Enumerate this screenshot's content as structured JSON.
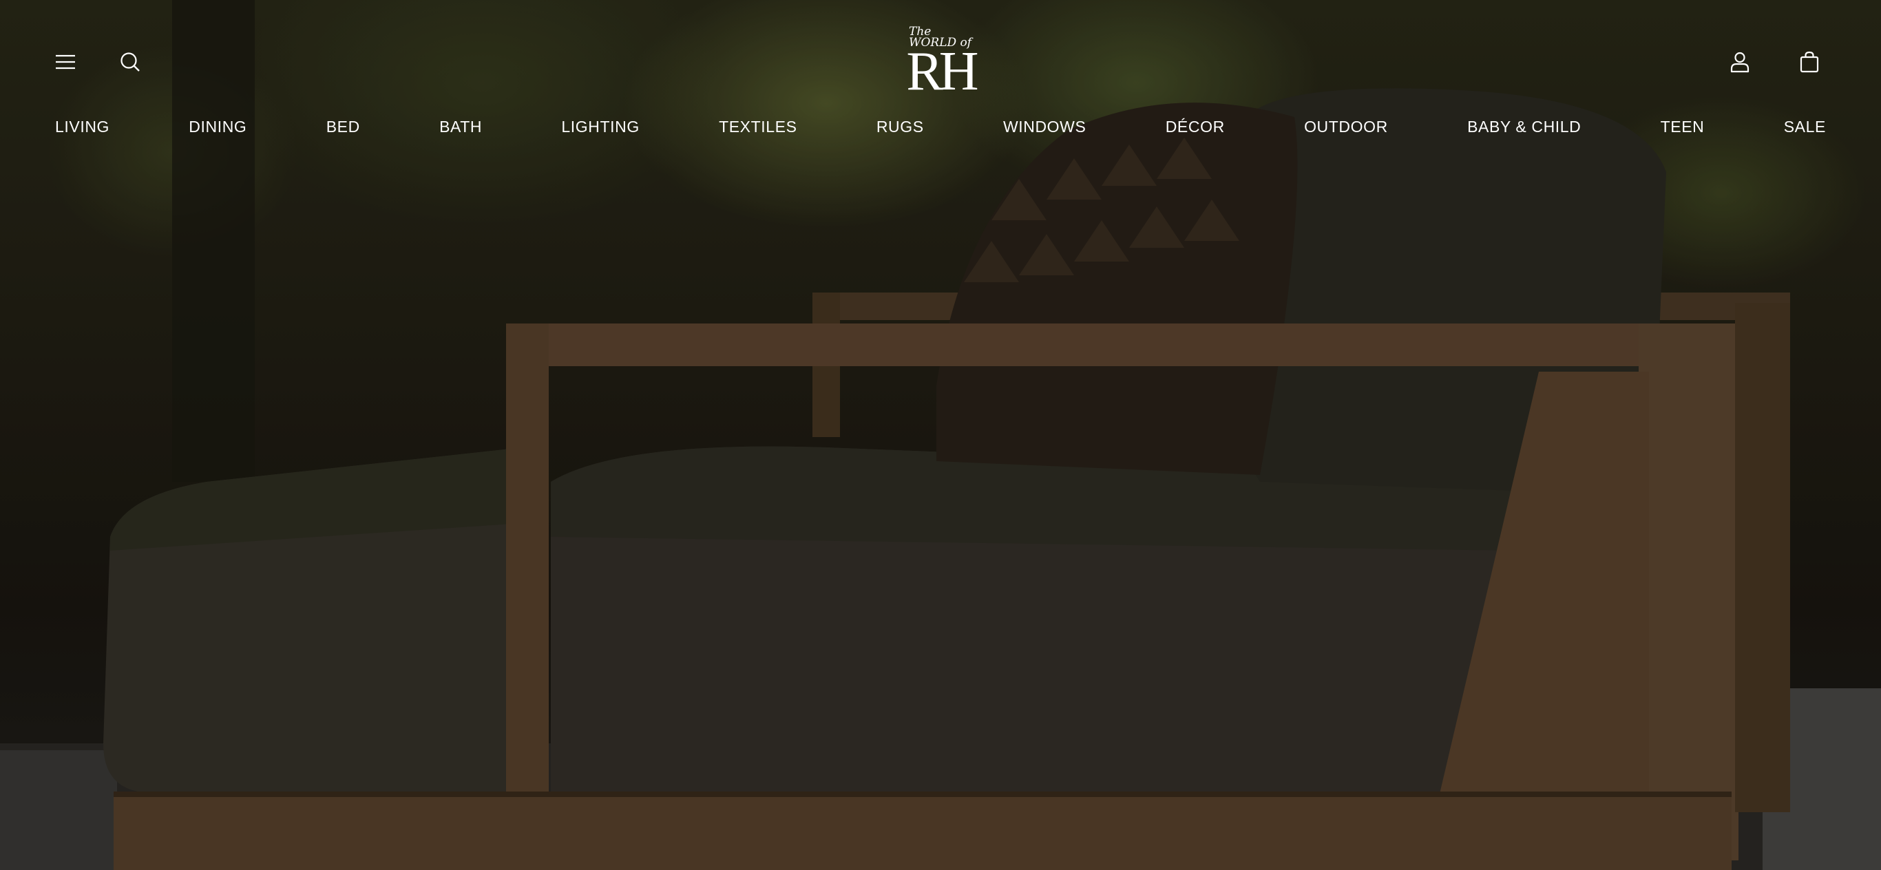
{
  "brand": {
    "logo_small": "The WORLD of",
    "logo_big": "RH"
  },
  "header": {
    "menu_icon": "hamburger-menu-icon",
    "search_icon": "search-icon",
    "account_icon": "user-account-icon",
    "cart_icon": "shopping-bag-icon"
  },
  "nav": {
    "items": [
      {
        "label": "LIVING"
      },
      {
        "label": "DINING"
      },
      {
        "label": "BED"
      },
      {
        "label": "BATH"
      },
      {
        "label": "LIGHTING"
      },
      {
        "label": "TEXTILES"
      },
      {
        "label": "RUGS"
      },
      {
        "label": "WINDOWS"
      },
      {
        "label": "DÉCOR"
      },
      {
        "label": "OUTDOOR"
      },
      {
        "label": "BABY & CHILD"
      },
      {
        "label": "TEEN"
      },
      {
        "label": "SALE"
      }
    ]
  },
  "colors": {
    "text": "#ffffff",
    "teak": "#6b4f32",
    "cushion": "#3a352c"
  }
}
